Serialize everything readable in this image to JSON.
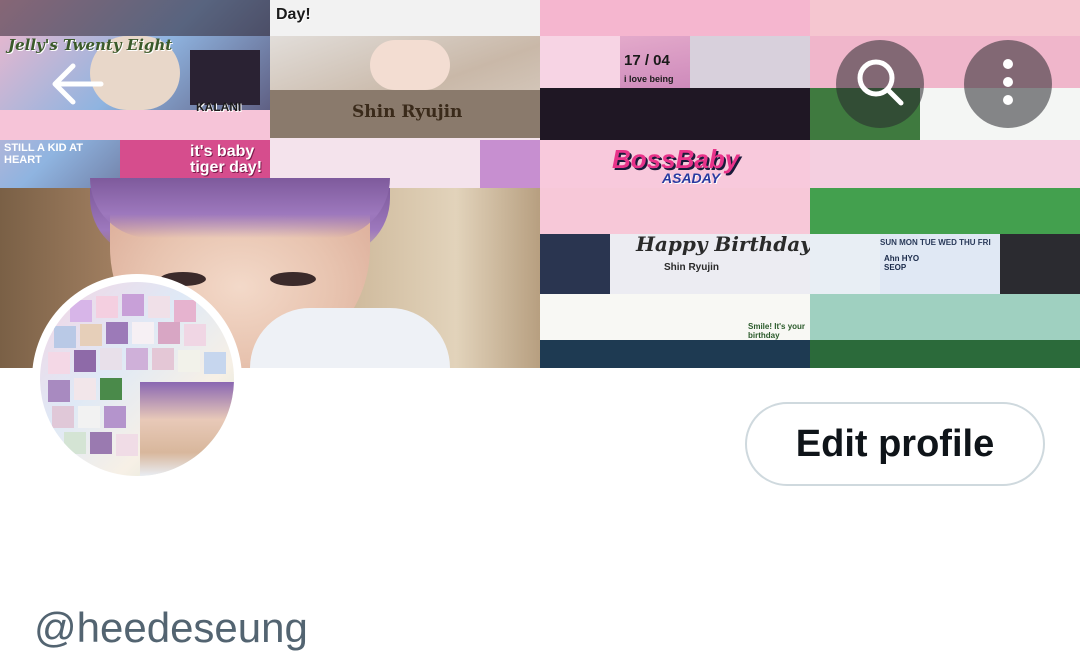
{
  "profile": {
    "handle": "@heedeseung"
  },
  "actions": {
    "edit_profile_label": "Edit profile"
  },
  "header": {
    "back_icon": "arrow-left-icon",
    "search_icon": "search-icon",
    "more_icon": "more-vertical-icon"
  },
  "banner": {
    "texts": {
      "jelly": "Jelly's Twenty Eight",
      "day": "Day!",
      "kalani": "KALANI",
      "shin": "Shin Ryujin",
      "kid": "STILL A KID AT HEART",
      "baby": "it's baby tiger day!",
      "date": "17 / 04",
      "loving": "i love being",
      "boss": "BossBaby",
      "asa": "ASADAY",
      "birthday": "Happy Birthday",
      "shin2": "Shin Ryujin",
      "smile": "Smile! It's your birthday",
      "weekdays": "SUN MON TUE WED THU FRI",
      "ahn": "Ahn HYO SEOP"
    }
  },
  "colors": {
    "text_primary": "#0f1419",
    "text_secondary": "#536471",
    "button_border": "#cfd9de",
    "background": "#ffffff"
  }
}
